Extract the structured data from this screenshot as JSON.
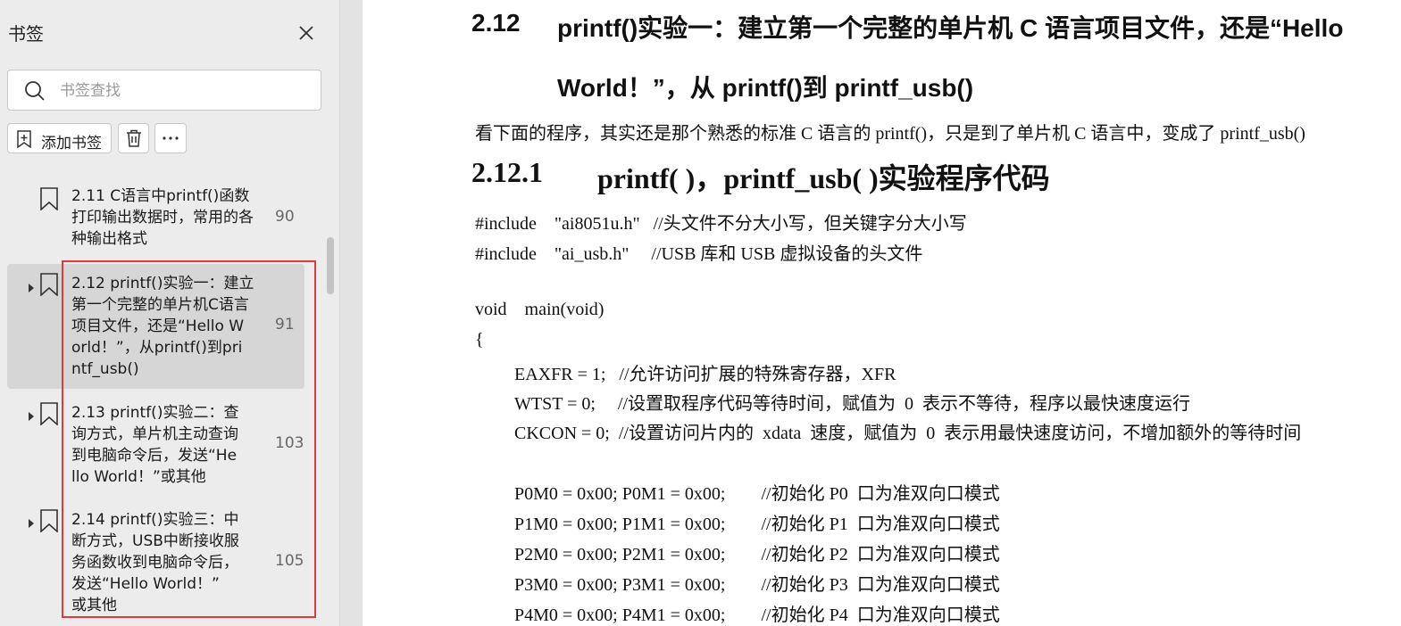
{
  "sidebar": {
    "title": "书签",
    "search_placeholder": "书签查找",
    "add_label": "添加书签",
    "bookmarks": [
      {
        "text": "2.11  C语言中printf()函数\n打印输出数据时，常用的各\n种输出格式",
        "page": "90"
      },
      {
        "text": "2.12  printf()实验一：建立\n第一个完整的单片机C语言\n项目文件，还是“Hello W\norld！”，从printf()到pri\nntf_usb()",
        "page": "91"
      },
      {
        "text": "2.13  printf()实验二：查\n询方式，单片机主动查询\n到电脑命令后，发送“He\nllo World！”或其他",
        "page": "103"
      },
      {
        "text": "2.14  printf()实验三：中\n断方式，USB中断接收服\n务函数收到电脑命令后，\n发送“Hello World！”\n或其他",
        "page": "105"
      }
    ]
  },
  "doc": {
    "section_num": "2.12",
    "section_title_1": "printf()实验一：建立第一个完整的单片机 C 语言项目文件，还是“Hello",
    "section_title_2": "World！”，从 printf()到 printf_usb()",
    "intro": "看下面的程序，其实还是那个熟悉的标准 C 语言的 printf()，只是到了单片机 C 语言中，变成了 printf_usb()",
    "subsection_num": "2.12.1",
    "subsection_title": "printf( )，printf_usb( )实验程序代码",
    "code_lines": [
      "#include    \"ai8051u.h\"   //头文件不分大小写，但关键字分大小写",
      "#include    \"ai_usb.h\"     //USB 库和 USB 虚拟设备的头文件",
      "void    main(void)",
      "{",
      "EAXFR = 1;   //允许访问扩展的特殊寄存器，XFR",
      "WTST = 0;     //设置取程序代码等待时间，赋值为  0  表示不等待，程序以最快速度运行",
      "CKCON = 0;  //设置访问片内的  xdata  速度，赋值为  0  表示用最快速度访问，不增加额外的等待时间",
      "P0M0 = 0x00; P0M1 = 0x00;        //初始化 P0  口为准双向口模式",
      "P1M0 = 0x00; P1M1 = 0x00;        //初始化 P1  口为准双向口模式",
      "P2M0 = 0x00; P2M1 = 0x00;        //初始化 P2  口为准双向口模式",
      "P3M0 = 0x00; P3M1 = 0x00;        //初始化 P3  口为准双向口模式",
      "P4M0 = 0x00; P4M1 = 0x00;        //初始化 P4  口为准双向口模式"
    ]
  }
}
